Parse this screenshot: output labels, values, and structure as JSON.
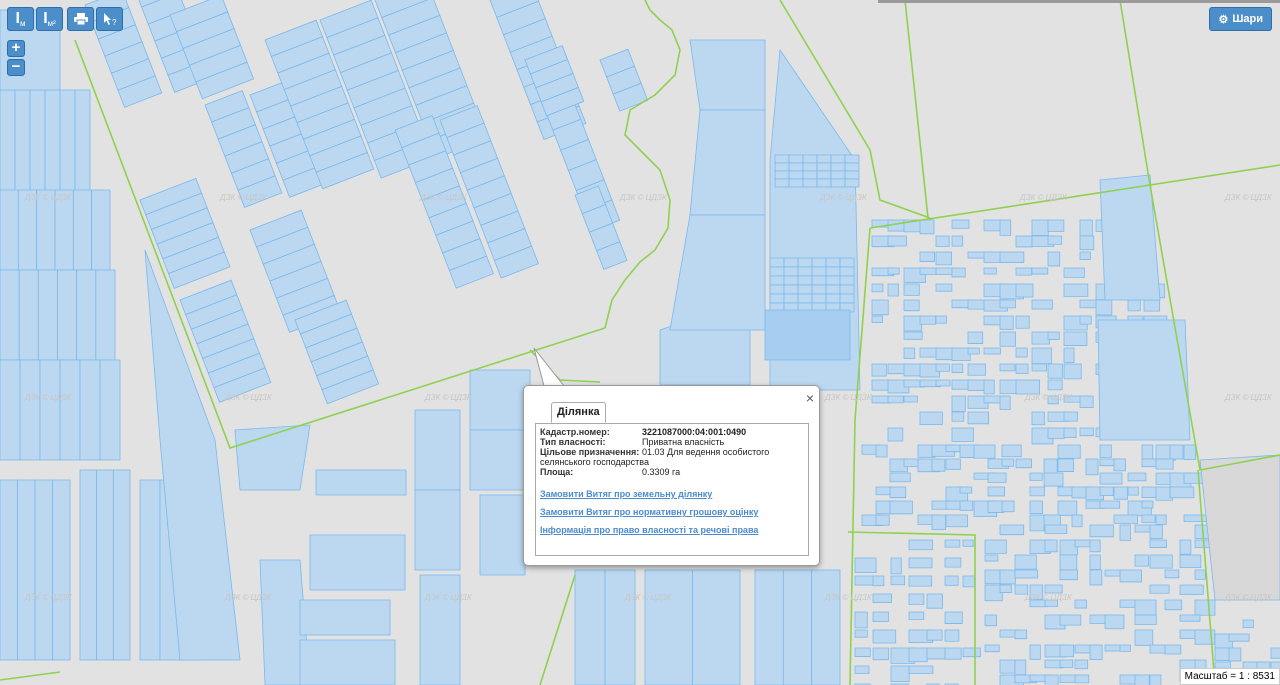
{
  "map": {
    "watermark": "ДЗК © ЦДЗК",
    "parcel_fill": "#bcd8f0",
    "parcel_stroke": "#7ab8ec",
    "boundary_color": "#8fd14f",
    "background": "#e2e2e2"
  },
  "toolbar": {
    "measure_line": "I",
    "measure_line_sub": "м",
    "measure_area": "I",
    "measure_area_sub": "м²",
    "print_icon": "print-icon",
    "identify_icon": "identify-icon"
  },
  "zoom": {
    "in": "+",
    "out": "−"
  },
  "layers": {
    "label": "Шари"
  },
  "popup": {
    "tab": "Ділянка",
    "close": "×",
    "fields": [
      {
        "key": "Кадастр.номер:",
        "value": "3221087000:04:001:0490"
      },
      {
        "key": "Тип власності:",
        "value": "Приватна власність"
      },
      {
        "key": "Цільове призначення:",
        "value": "01.03 Для ведення особистого селянського господарства"
      },
      {
        "key": "Площа:",
        "value": "0.3309 га"
      }
    ],
    "links": [
      "Замовити Витяг про земельну ділянку",
      "Замовити Витяг про нормативну грошову оцінку",
      "Інформація про право власності та речові права"
    ]
  },
  "scale": {
    "label": "Масштаб = 1 : 8531"
  }
}
